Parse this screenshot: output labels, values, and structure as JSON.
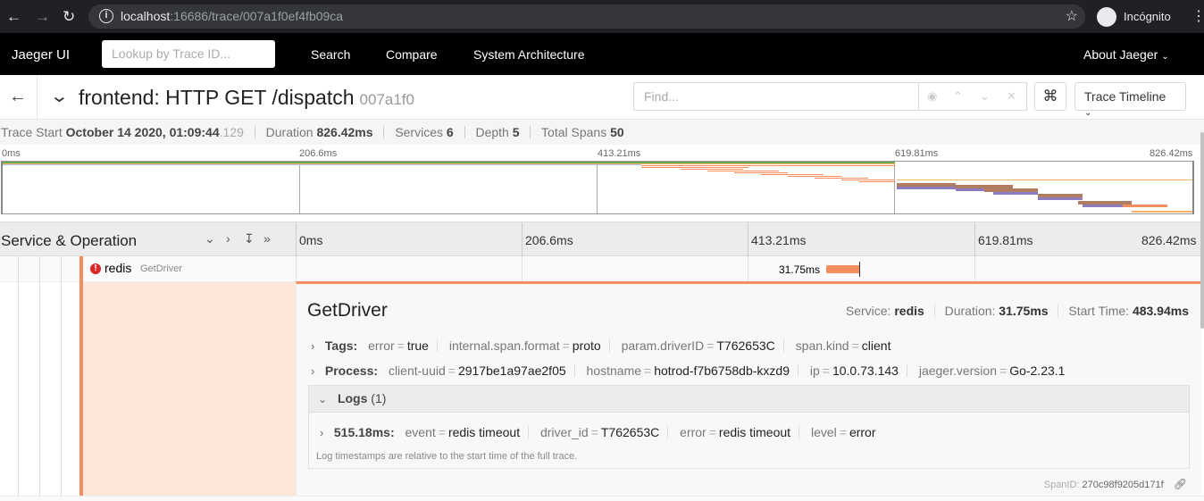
{
  "browser": {
    "url_host": "localhost",
    "url_path": ":16686/trace/007a1f0ef4fb09ca",
    "profile_label": "Incógnito"
  },
  "topnav": {
    "brand": "Jaeger UI",
    "lookup_placeholder": "Lookup by Trace ID...",
    "links": [
      "Search",
      "Compare",
      "System Architecture"
    ],
    "about": "About Jaeger"
  },
  "trace_header": {
    "title": "frontend: HTTP GET /dispatch",
    "trace_id": "007a1f0",
    "find_placeholder": "Find...",
    "cmd_glyph": "⌘",
    "view_select": "Trace Timeline"
  },
  "summary": {
    "trace_start_label": "Trace Start",
    "trace_start_value": "October 14 2020, 01:09:44",
    "trace_start_ms": ".129",
    "duration_label": "Duration",
    "duration_value": "826.42ms",
    "services_label": "Services",
    "services_value": "6",
    "depth_label": "Depth",
    "depth_value": "5",
    "total_spans_label": "Total Spans",
    "total_spans_value": "50"
  },
  "minimap": {
    "ticks": [
      "0ms",
      "206.6ms",
      "413.21ms",
      "619.81ms",
      "826.42ms"
    ]
  },
  "timeline_header": {
    "label": "Service & Operation",
    "ticks": [
      "0ms",
      "206.6ms",
      "413.21ms",
      "619.81ms",
      "826.42ms"
    ]
  },
  "span": {
    "service": "redis",
    "operation": "GetDriver",
    "duration_label": "31.75ms",
    "error": true,
    "accent_color": "#f58d5f"
  },
  "detail": {
    "name": "GetDriver",
    "service_label": "Service:",
    "service_value": "redis",
    "duration_label": "Duration:",
    "duration_value": "31.75ms",
    "start_label": "Start Time:",
    "start_value": "483.94ms",
    "tags_label": "Tags:",
    "tags": [
      {
        "k": "error",
        "v": "true"
      },
      {
        "k": "internal.span.format",
        "v": "proto"
      },
      {
        "k": "param.driverID",
        "v": "T762653C"
      },
      {
        "k": "span.kind",
        "v": "client"
      }
    ],
    "process_label": "Process:",
    "process": [
      {
        "k": "client-uuid",
        "v": "2917be1a97ae2f05"
      },
      {
        "k": "hostname",
        "v": "hotrod-f7b6758db-kxzd9"
      },
      {
        "k": "ip",
        "v": "10.0.73.143"
      },
      {
        "k": "jaeger.version",
        "v": "Go-2.23.1"
      }
    ],
    "logs_label": "Logs",
    "logs_count": "(1)",
    "log_time": "515.18ms:",
    "log_fields": [
      {
        "k": "event",
        "v": "redis timeout"
      },
      {
        "k": "driver_id",
        "v": "T762653C"
      },
      {
        "k": "error",
        "v": "redis timeout"
      },
      {
        "k": "level",
        "v": "error"
      }
    ],
    "log_note": "Log timestamps are relative to the start time of the full trace.",
    "span_id_label": "SpanID:",
    "span_id_value": "270c98f9205d171f"
  }
}
